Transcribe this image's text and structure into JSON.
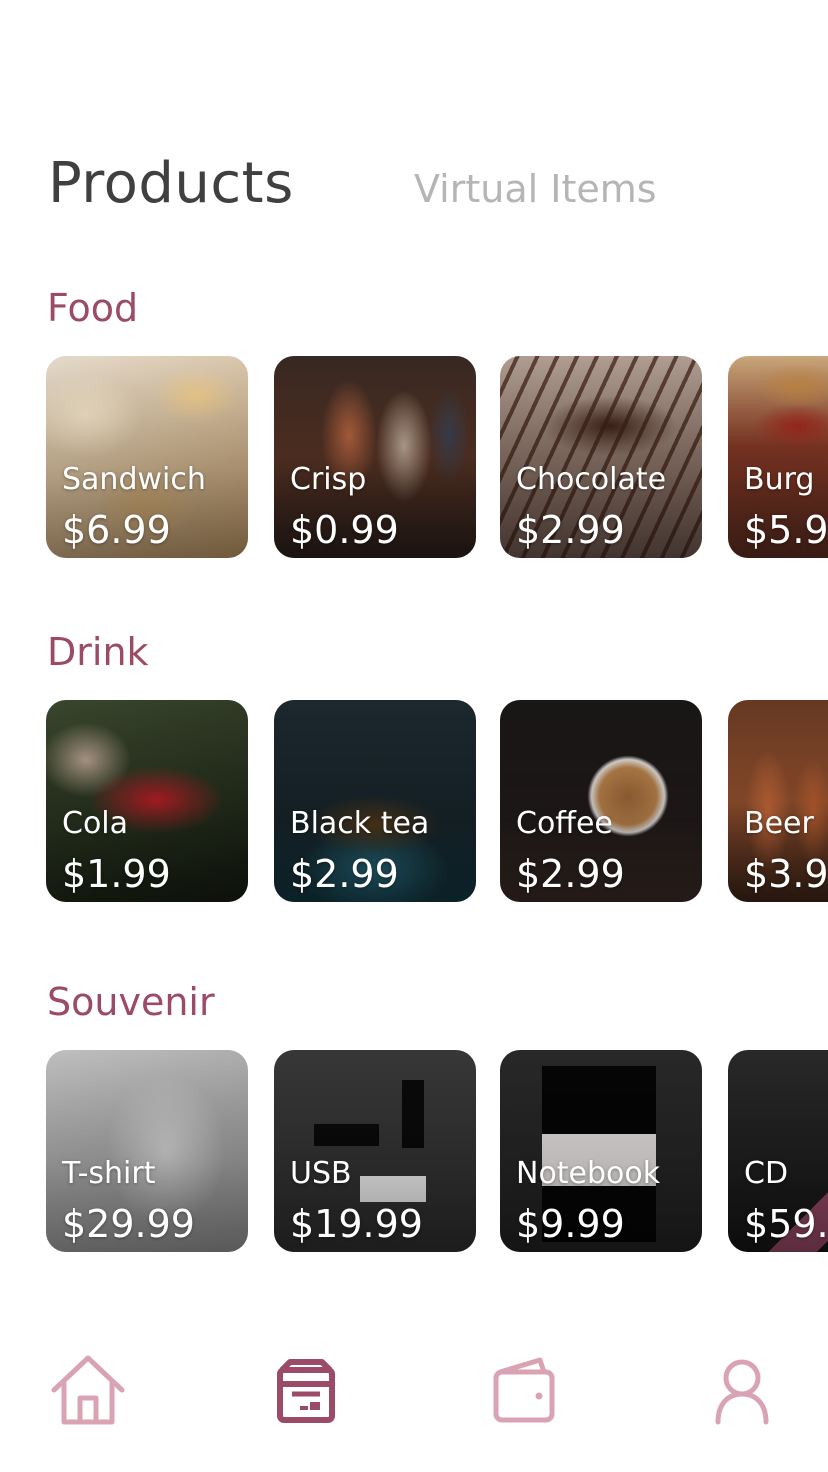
{
  "header": {
    "tab_products": "Products",
    "tab_virtual_items": "Virtual Items"
  },
  "colors": {
    "accent": "#9b4a68",
    "nav_icon": "#d9a3b4",
    "nav_icon_active": "#9b4a68",
    "title_text": "#404040",
    "inactive_tab": "#b5b5b5"
  },
  "sections": [
    {
      "title": "Food",
      "items": [
        {
          "name": "Sandwich",
          "price": "$6.99"
        },
        {
          "name": "Crisp",
          "price": "$0.99"
        },
        {
          "name": "Chocolate",
          "price": "$2.99"
        },
        {
          "name": "Burg",
          "price": "$5.9"
        }
      ]
    },
    {
      "title": "Drink",
      "items": [
        {
          "name": "Cola",
          "price": "$1.99"
        },
        {
          "name": "Black tea",
          "price": "$2.99"
        },
        {
          "name": "Coffee",
          "price": "$2.99"
        },
        {
          "name": "Beer",
          "price": "$3.9"
        }
      ]
    },
    {
      "title": "Souvenir",
      "items": [
        {
          "name": "T-shirt",
          "price": "$29.99"
        },
        {
          "name": "USB",
          "price": "$19.99"
        },
        {
          "name": "Notebook",
          "price": "$9.99"
        },
        {
          "name": "CD",
          "price": "$59."
        }
      ]
    }
  ],
  "nav": {
    "items": [
      {
        "icon": "home-icon",
        "active": false
      },
      {
        "icon": "store-icon",
        "active": true
      },
      {
        "icon": "wallet-icon",
        "active": false
      },
      {
        "icon": "profile-icon",
        "active": false
      }
    ]
  }
}
